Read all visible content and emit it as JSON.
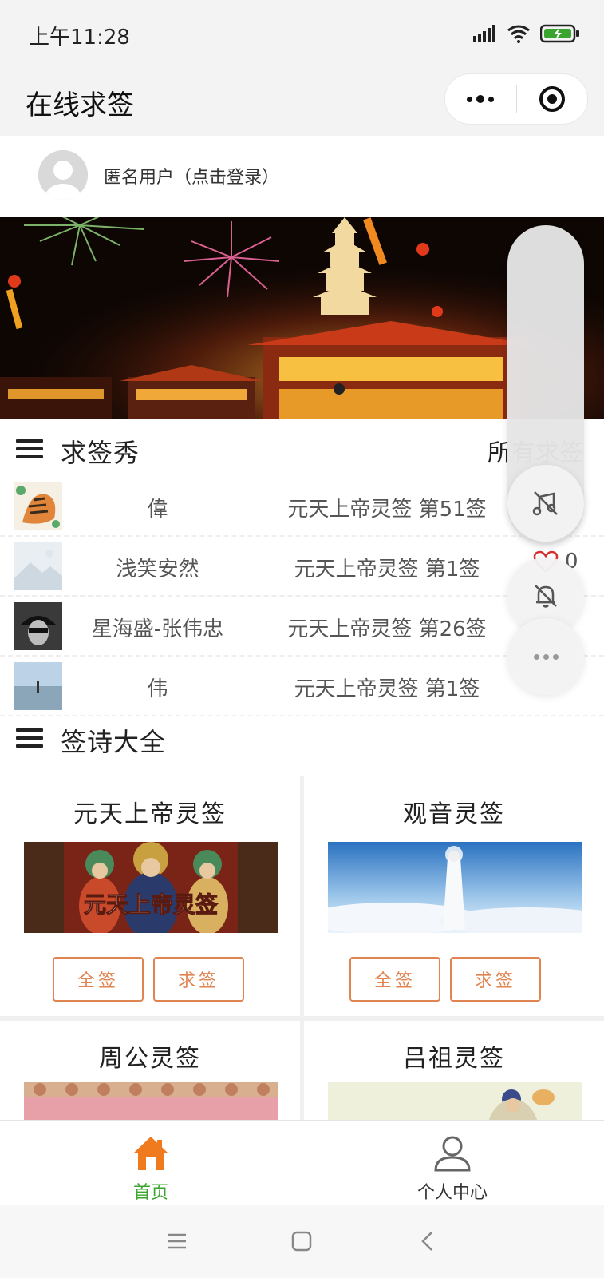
{
  "status_bar": {
    "time": "上午11:28"
  },
  "title_bar": {
    "title": "在线求签"
  },
  "user": {
    "label": "匿名用户（点击登录）"
  },
  "sections": {
    "draws_title": "求签秀",
    "draws_link": "所有求签",
    "poems_title": "签诗大全"
  },
  "draws": [
    {
      "name": "偉",
      "sign": "元天上帝灵签 第51签",
      "likes": ""
    },
    {
      "name": "浅笑安然",
      "sign": "元天上帝灵签 第1签",
      "likes": "0"
    },
    {
      "name": "星海盛-张伟忠",
      "sign": "元天上帝灵签 第26签",
      "likes": ""
    },
    {
      "name": "伟",
      "sign": "元天上帝灵签 第1签",
      "likes": ""
    }
  ],
  "cards": [
    {
      "title": "元天上帝灵签",
      "image_caption": "元天上帝灵签",
      "all_label": "全签",
      "draw_label": "求签"
    },
    {
      "title": "观音灵签",
      "all_label": "全签",
      "draw_label": "求签"
    },
    {
      "title": "周公灵签"
    },
    {
      "title": "吕祖灵签"
    }
  ],
  "tabs": [
    {
      "label": "首页",
      "icon": "home-icon",
      "active": true
    },
    {
      "label": "个人中心",
      "icon": "user-icon",
      "active": false
    }
  ],
  "colors": {
    "accent_green": "#3aa52e",
    "accent_orange": "#e08552",
    "home_icon": "#f07a1e",
    "like_red": "#d62e2e"
  }
}
